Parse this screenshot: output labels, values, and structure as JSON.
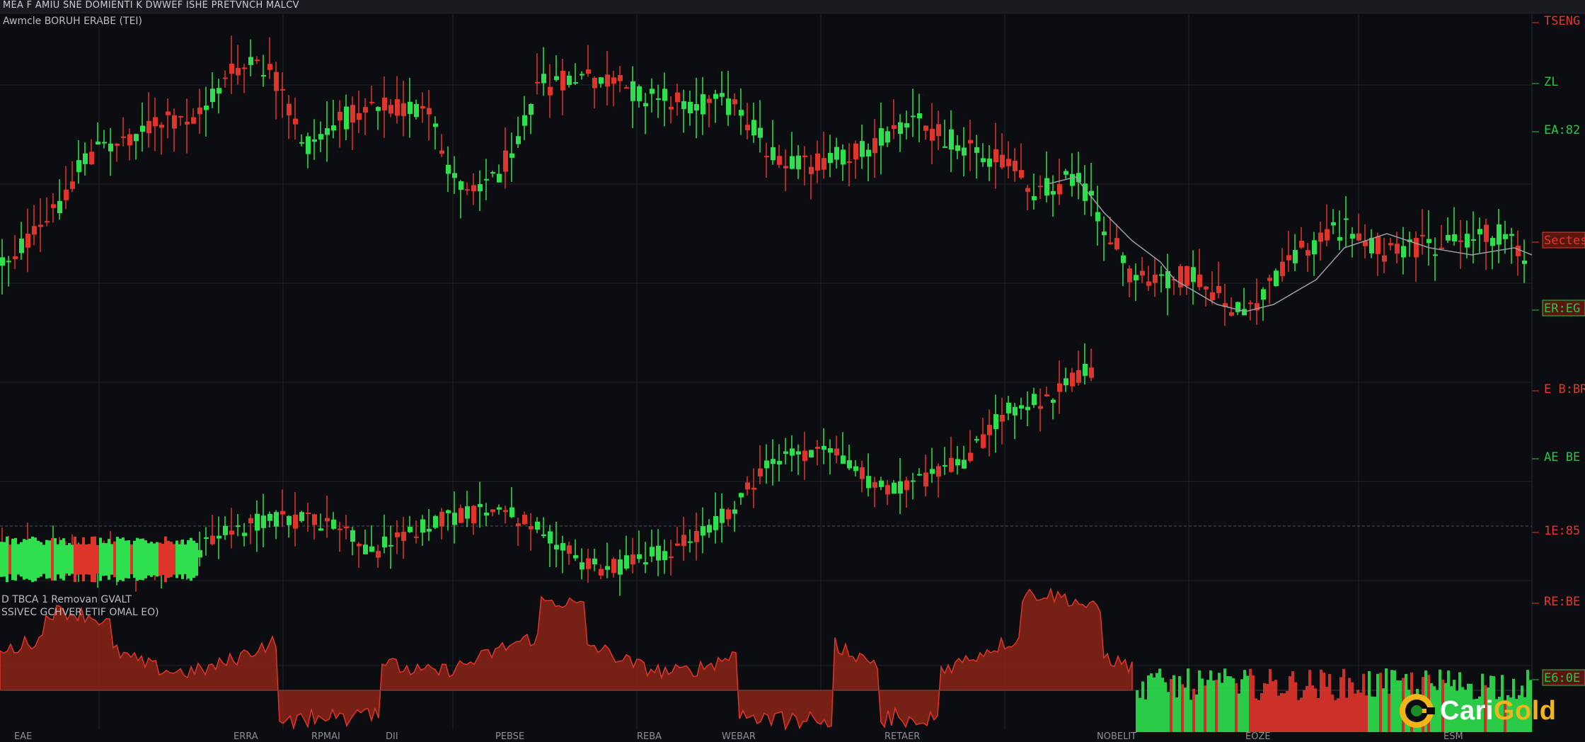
{
  "header": {
    "title": "MEA F AMIU SNE DOMIENTI K DWWEF ISHE PRETVNCH MALCV",
    "subtitle": "Awmcle BORUH ERABE (TEI)"
  },
  "indicator_panel": {
    "title_line1": "D TBCA 1 Removan GVALT",
    "title_line2": "SSIVEC GCHVER ETIF OMAL EO)"
  },
  "price_axis": {
    "labels": [
      "TSENG",
      "ZL",
      "EA:82",
      "Sectes",
      "ER:EG",
      "E B:BR",
      "AE BE",
      "1E:85",
      "RE:BE",
      "E6:0E"
    ],
    "colors": [
      "#e03a2e",
      "#2ec44a",
      "#2ec44a",
      "#e03a2e",
      "#2ec44a",
      "#e03a2e",
      "#2ec44a",
      "#e03a2e",
      "#e03a2e",
      "#2ec44a"
    ],
    "box_label_index": [
      3,
      4,
      9
    ]
  },
  "time_axis": {
    "labels": [
      "EAE",
      "ERRA",
      "RPMAI",
      "DII",
      "PEBSE",
      "REBA",
      "WEBAR",
      "RETAER",
      "NOBELIT",
      "EOZE",
      "ESM"
    ]
  },
  "logo": {
    "text_white": "Cari",
    "text_gold": "Gold",
    "icon": "carigold-c-logo-icon"
  },
  "colors": {
    "up": "#2ee04e",
    "down": "#e0352b",
    "background": "#0c0d11",
    "grid": "#1f2229",
    "line": "#9a9ea8",
    "gold": "#f2b417"
  },
  "chart_data": {
    "type": "candlestick",
    "title": "MEA F AMIU SNE DOMIENTI K DWWEF ISHE PRETVNCH MALCV",
    "grid": true,
    "series": [
      {
        "type": "candlestick",
        "approx_candles": 220,
        "upper_trend": "rise to peak near x=340, second peak near x=750, decline toward x=1100, recovery to right edge",
        "lower_trend": "flat near y=540, dip, steady rise from x=800 to x=1600"
      },
      {
        "type": "line",
        "path": "smoothed overlay from x=1480 to x=2160"
      },
      {
        "type": "area",
        "panel": "indicator",
        "colors": [
          "#e0352b",
          "#2ee04e"
        ]
      }
    ]
  }
}
